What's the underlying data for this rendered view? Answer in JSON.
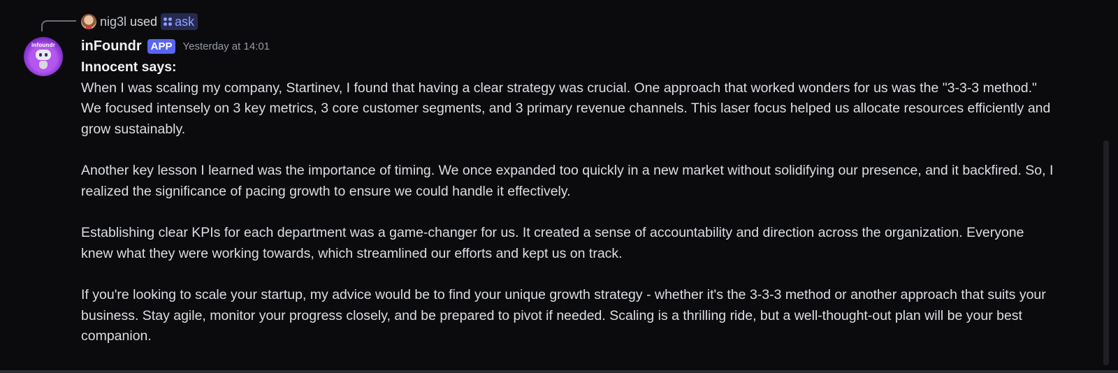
{
  "reply": {
    "user": "nig3l",
    "action": "used",
    "command": "ask"
  },
  "message": {
    "author": "inFoundr",
    "badge": "APP",
    "timestamp": "Yesterday at 14:01",
    "avatar_label": "infoundr",
    "heading": "Innocent says:",
    "paragraphs": [
      "When I was scaling my company, Startinev, I found that having a clear strategy was crucial. One approach that worked wonders for us was the \"3-3-3 method.\" We focused intensely on 3 key metrics, 3 core customer segments, and 3 primary revenue channels. This laser focus helped us allocate resources efficiently and grow sustainably.",
      "Another key lesson I learned was the importance of timing. We once expanded too quickly in a new market without solidifying our presence, and it backfired. So, I realized the significance of pacing growth to ensure we could handle it effectively.",
      "Establishing clear KPIs for each department was a game-changer for us. It created a sense of accountability and direction across the organization. Everyone knew what they were working towards, which streamlined our efforts and kept us on track.",
      "If you're looking to scale your startup, my advice would be to find your unique growth strategy - whether it's the 3-3-3 method or another approach that suits your business. Stay agile, monitor your progress closely, and be prepared to pivot if needed. Scaling is a thrilling ride, but a well-thought-out plan will be your best companion."
    ]
  },
  "colors": {
    "background": "#0b0b0e",
    "text": "#dbdee1",
    "badge": "#5865f2",
    "command_chip": "#262a52",
    "command_text": "#8ea1ff",
    "timestamp": "#949ba4"
  }
}
